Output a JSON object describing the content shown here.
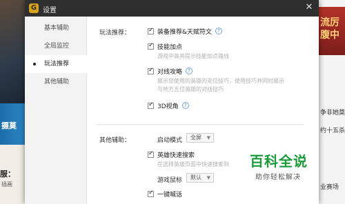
{
  "window": {
    "logo": "G",
    "title": "设置",
    "close_glyph": "✕"
  },
  "sidebar": {
    "items": [
      {
        "label": "基本辅助",
        "active": false
      },
      {
        "label": "全局监控",
        "active": false
      },
      {
        "label": "玩法推荐",
        "active": true
      },
      {
        "label": "其他辅助",
        "active": false
      }
    ]
  },
  "sections": {
    "gameplay_label": "玩法推荐：",
    "other_label": "其他辅助："
  },
  "gameplay_options": [
    {
      "label": "装备推荐&天赋符文",
      "checked": true,
      "help": true,
      "desc": ""
    },
    {
      "label": "技能加点",
      "checked": true,
      "help": false,
      "desc": "游戏中高亮提示技能加点路线"
    },
    {
      "label": "对线攻略",
      "checked": true,
      "help": true,
      "desc_lines": [
        "展示您使用的英雄的走位技巧，使用技巧并同时展示",
        "与地方五位英雄的对线技巧"
      ]
    },
    {
      "label": "3D视角",
      "checked": true,
      "help": true,
      "desc": ""
    }
  ],
  "other": {
    "launch_mode_label": "启动模式",
    "launch_mode_value": "全屏",
    "hero_search_label": "英雄快速搜索",
    "hero_search_checked": true,
    "hero_search_desc": "在选择英雄页面中快速搜索到",
    "mouse_label": "游戏鼠标",
    "mouse_value": "默认",
    "shout_label": "一键喊话",
    "shout_checked": true
  },
  "help_glyph": "?",
  "background": {
    "left_band_text": "摄莫",
    "left_card_title": "服：",
    "left_card_sub": "插画",
    "right_banner_text": "流厉\n腹中",
    "right_lines": [
      "争非她莫属",
      "约十五杀",
      "业赛场"
    ]
  },
  "watermark": {
    "title": "百科全说",
    "subtitle": "助你轻松解决"
  },
  "colors": {
    "titlebar": "#2f2f2f",
    "sidebar": "#f3f3f3",
    "help_blue": "#4a8ed0",
    "watermark_green": "#1a9a3a"
  }
}
